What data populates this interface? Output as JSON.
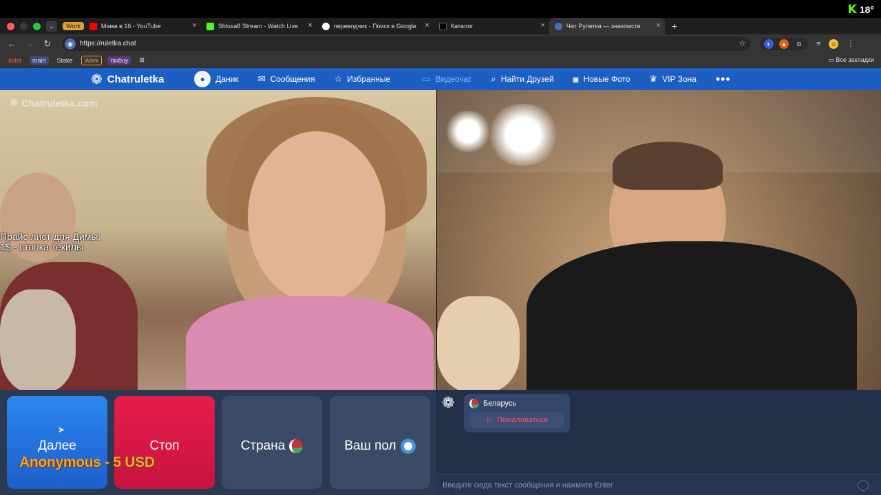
{
  "window": {
    "tab_group_label": "Work",
    "tabs": [
      {
        "title": "Мама в 16 - YouTube",
        "favicon_color": "#ff0000"
      },
      {
        "title": "Shluxa8 Stream - Watch Live",
        "favicon_color": "#53fc18"
      },
      {
        "title": "переводчик - Поиск в Google",
        "favicon_color": "#4285f4"
      },
      {
        "title": "Каталог",
        "favicon_color": "#000000"
      },
      {
        "title": "Чат Рулетка — знакомств",
        "favicon_color": "#4a6fb5"
      }
    ],
    "url": "https://ruletka.chat",
    "bookmarks": [
      "aslot",
      "main",
      "Stake",
      "Work",
      "nixbuy"
    ],
    "all_bookmarks_label": "Все закладки",
    "kick_badge_text": "18°"
  },
  "site": {
    "brand_name": "Chatruletka",
    "nav": {
      "profile": "Даник",
      "messages": "Сообщения",
      "favorites": "Избранные",
      "videochat": "Видеочат",
      "find_friends": "Найти Друзей",
      "new_photos": "Новые Фото",
      "vip": "VIP Зона",
      "more": "•••"
    },
    "accent_color": "#1d5ec3",
    "active_nav_color": "#7cc4ff"
  },
  "video": {
    "watermark": "Chatruletka.com",
    "overlay_line1": "Прайс лист для Димы:",
    "overlay_line2": "1$ - стопка текилы"
  },
  "controls": {
    "next": "Далее",
    "stop": "Стоп",
    "country": "Страна",
    "gender": "Ваш пол",
    "donation": "Anonymous - 5 USD"
  },
  "chat": {
    "partner_country": "Беларусь",
    "report": "Пожаловаться",
    "input_placeholder": "Введите сюда текст сообщения и нажмите Enter"
  }
}
